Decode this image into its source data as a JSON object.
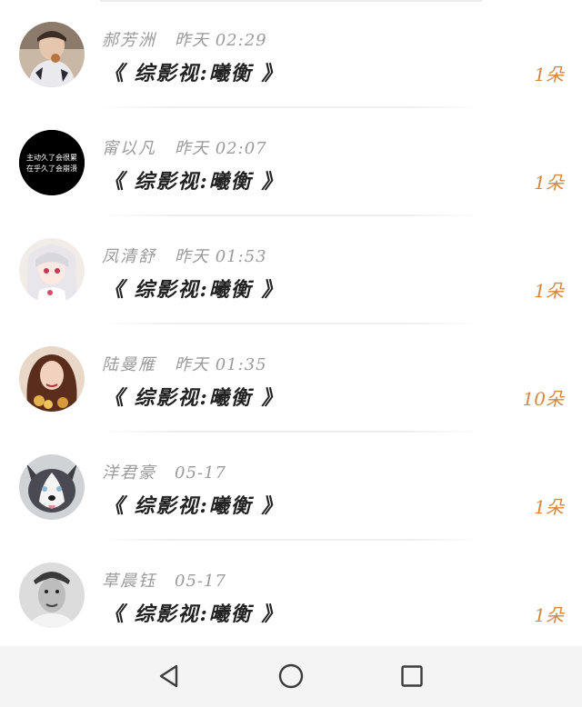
{
  "gift_list": {
    "items": [
      {
        "name": "郝芳洲",
        "time": "昨天 02:29",
        "message": "《 综影视:曦衡 》",
        "count": "1朵",
        "avatar": "young-man-avatar"
      },
      {
        "name": "甯以凡",
        "time": "昨天 02:07",
        "message": "《 综影视:曦衡 》",
        "count": "1朵",
        "avatar": "black-text-avatar",
        "avatar_text": [
          "主动久了会很累",
          "在乎久了会崩溃"
        ]
      },
      {
        "name": "凤清舒",
        "time": "昨天 01:53",
        "message": "《 综影视:曦衡 》",
        "count": "1朵",
        "avatar": "anime-girl-avatar"
      },
      {
        "name": "陆曼雁",
        "time": "昨天 01:35",
        "message": "《 综影视:曦衡 》",
        "count": "10朵",
        "avatar": "woman-flowers-avatar"
      },
      {
        "name": "洋君豪",
        "time": "05-17",
        "message": "《 综影视:曦衡 》",
        "count": "1朵",
        "avatar": "husky-dog-avatar"
      },
      {
        "name": "草晨钰",
        "time": "05-17",
        "message": "《 综影视:曦衡 》",
        "count": "1朵",
        "avatar": "man-portrait-avatar"
      }
    ]
  },
  "colors": {
    "name": "#9a9a9a",
    "message": "#222222",
    "count": "#d4883f",
    "navbar": "#f4f4f4"
  },
  "navbar": {
    "back": "triangle-back-icon",
    "home": "circle-home-icon",
    "recents": "square-recents-icon"
  }
}
